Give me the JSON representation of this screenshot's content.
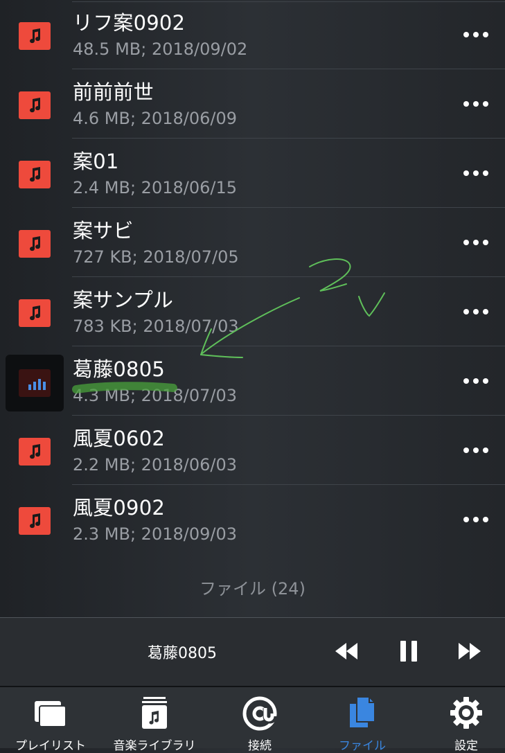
{
  "files": [
    {
      "title": "リフ案0902",
      "meta": "48.5 MB; 2018/09/02",
      "playing": false
    },
    {
      "title": "前前前世",
      "meta": "4.6 MB; 2018/06/09",
      "playing": false
    },
    {
      "title": "案01",
      "meta": "2.4 MB; 2018/06/15",
      "playing": false
    },
    {
      "title": "案サビ",
      "meta": "727 KB; 2018/07/05",
      "playing": false
    },
    {
      "title": "案サンプル",
      "meta": "783 KB; 2018/07/03",
      "playing": false
    },
    {
      "title": "葛藤0805",
      "meta": "4.3 MB; 2018/07/03",
      "playing": true
    },
    {
      "title": "風夏0602",
      "meta": "2.2 MB; 2018/06/03",
      "playing": false
    },
    {
      "title": "風夏0902",
      "meta": "2.3 MB; 2018/09/03",
      "playing": false
    }
  ],
  "file_count_label": "ファイル (24)",
  "player": {
    "now_playing": "葛藤0805",
    "state": "playing"
  },
  "tabs": [
    {
      "label": "プレイリスト",
      "icon": "playlist-icon",
      "active": false
    },
    {
      "label": "音楽ライブラリ",
      "icon": "music-library-icon",
      "active": false
    },
    {
      "label": "接続",
      "icon": "at-sign-icon",
      "active": false
    },
    {
      "label": "ファイル",
      "icon": "files-icon",
      "active": true
    },
    {
      "label": "設定",
      "icon": "gear-icon",
      "active": false
    }
  ],
  "colors": {
    "accent": "#3a86e0",
    "file_icon": "#ee4a3c",
    "meta_text": "#9a9ea4",
    "annotation": "#5fbf5a"
  }
}
